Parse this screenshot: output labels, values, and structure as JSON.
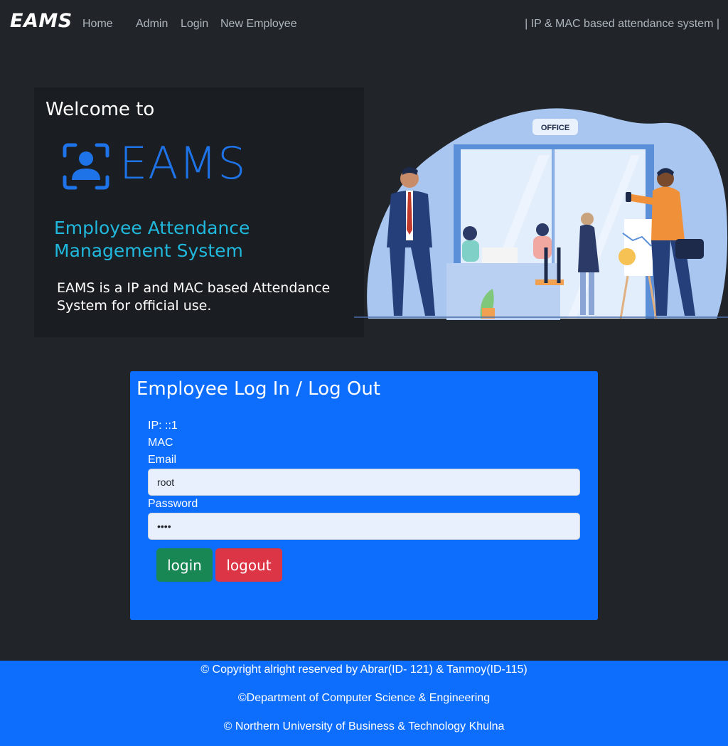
{
  "navbar": {
    "brand": "EAMS",
    "links": [
      "Home",
      "Admin",
      "Login",
      "New Employee"
    ],
    "tagline": "| IP & MAC based attendance system |"
  },
  "welcome": {
    "title": "Welcome to",
    "logo_text": "EAMS",
    "subtitle_line1": "Employee Attendance",
    "subtitle_line2": "Management System",
    "description": "EAMS is a IP and MAC based Attendance System for official use.",
    "illustration_sign": "OFFICE"
  },
  "login": {
    "title": "Employee Log In / Log Out",
    "ip_label": "IP: ::1",
    "mac_label": "MAC",
    "email_label": "Email",
    "email_value": "root",
    "password_label": "Password",
    "password_value": "root",
    "login_button": "login",
    "logout_button": "logout"
  },
  "footer": {
    "line1": "© Copyright alright reserved by Abrar(ID- 121) & Tanmoy(ID-115)",
    "line2": "©Department of Computer Science & Engineering",
    "line3": "© Northern University of Business & Technology Khulna"
  },
  "colors": {
    "background": "#212529",
    "primary": "#0d6efd",
    "success": "#198754",
    "danger": "#dc3545",
    "logo_blue": "#1e73e8",
    "subtitle_cyan": "#20b8dc"
  }
}
